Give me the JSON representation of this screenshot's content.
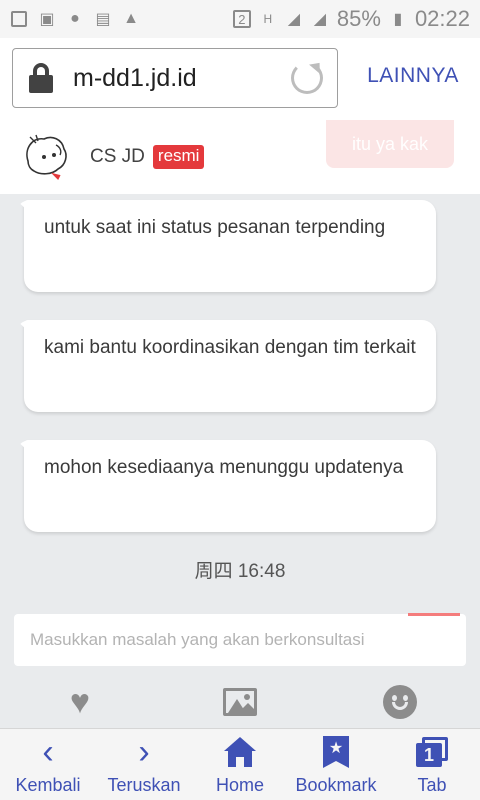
{
  "status_bar": {
    "notification_icons": [
      "image-icon",
      "wifi-icon",
      "messenger-icon",
      "gift-icon",
      "warning-icon"
    ],
    "sim_badge": "2",
    "network_type": "H",
    "battery_percent": "85%",
    "time": "02:22"
  },
  "browser": {
    "url": "m-dd1.jd.id",
    "menu_label": "LAINNYA"
  },
  "chat": {
    "agent_name": "CS JD",
    "official_badge": "resmi",
    "toast_text": "itu ya kak",
    "messages": [
      {
        "text": "untuk saat ini status pesanan terpending"
      },
      {
        "text": "kami bantu koordinasikan dengan tim terkait"
      },
      {
        "text": "mohon kesediaanya menunggu updatenya"
      }
    ],
    "timestamp": "周四 16:48",
    "input_placeholder": "Masukkan masalah yang akan berkonsultasi"
  },
  "tools": [
    "heart-icon",
    "image-icon",
    "emoji-icon"
  ],
  "nav": {
    "back": "Kembali",
    "forward": "Teruskan",
    "home": "Home",
    "bookmark": "Bookmark",
    "tab": "Tab",
    "tab_count": "1"
  },
  "colors": {
    "accent": "#3f51b5",
    "badge_red": "#e4393c",
    "chat_background": "#e9ebed"
  }
}
